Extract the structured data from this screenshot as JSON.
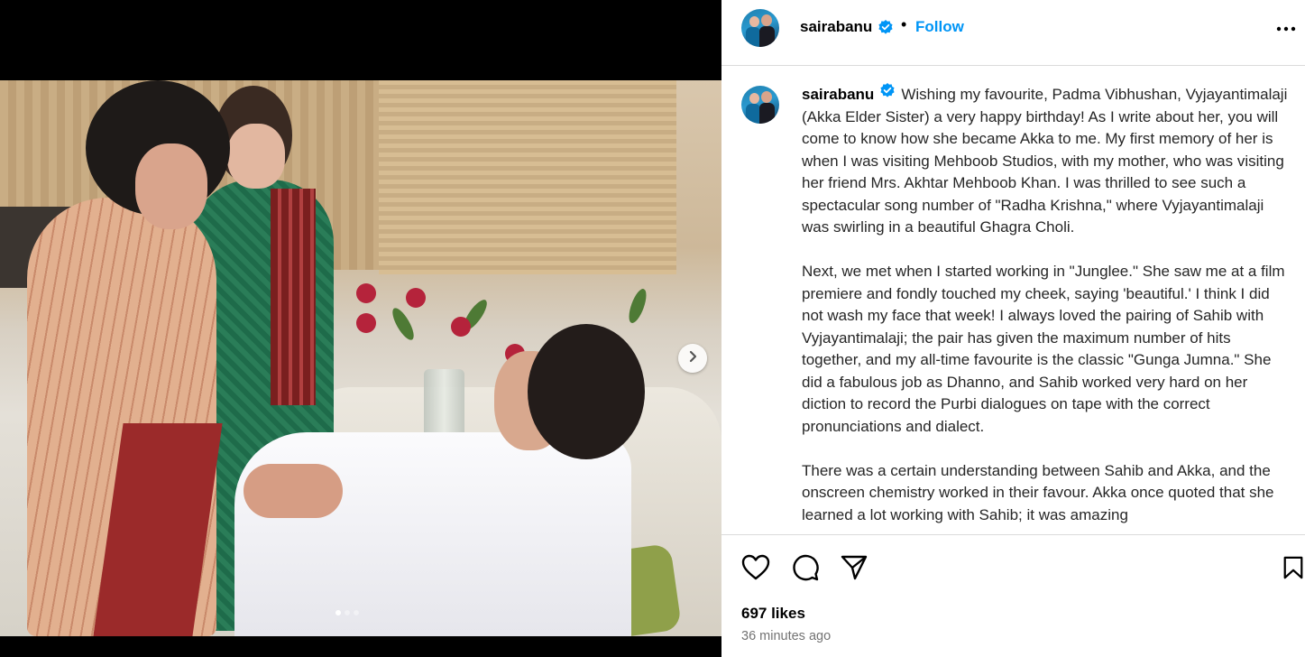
{
  "post": {
    "username": "sairabanu",
    "follow_label": "Follow",
    "separator": "•",
    "caption_paragraphs": [
      "Wishing my favourite, Padma Vibhushan, Vyjayantimalaji (Akka Elder Sister) a very happy birthday! As I write about her, you will come to know how she became Akka to me. My first memory of her is when I was visiting Mehboob Studios, with my mother, who was visiting her friend Mrs. Akhtar Mehboob Khan. I was thrilled to see such a spectacular song number of \"Radha Krishna,\" where Vyjayantimalaji was swirling in a beautiful Ghagra Choli.",
      "Next, we met when I started working in \"Junglee.\" She saw me at a film premiere and fondly touched my cheek, saying 'beautiful.' I think I did not wash my face that week! I always loved the pairing of Sahib with Vyjayantimalaji; the pair has given the maximum number of hits together, and my all-time favourite is the classic \"Gunga Jumna.\" She did a fabulous job as Dhanno, and Sahib worked very hard on her diction to record the Purbi dialogues on tape with the correct pronunciations and dialect.",
      "There was a certain understanding between Sahib and Akka, and the onscreen chemistry worked in their favour. Akka once quoted that she learned a lot working with Sahib; it was amazing"
    ],
    "likes": "697 likes",
    "time": "36 minutes ago"
  },
  "carousel": {
    "current": 1,
    "total": 3
  },
  "colors": {
    "follow": "#0095f6",
    "verified": "#0095f6",
    "muted": "#737373",
    "border": "#dbdbdb"
  },
  "icons": [
    "verified-badge-icon",
    "more-options-icon",
    "next-arrow-icon",
    "heart-icon",
    "comment-icon",
    "share-icon",
    "bookmark-icon"
  ]
}
